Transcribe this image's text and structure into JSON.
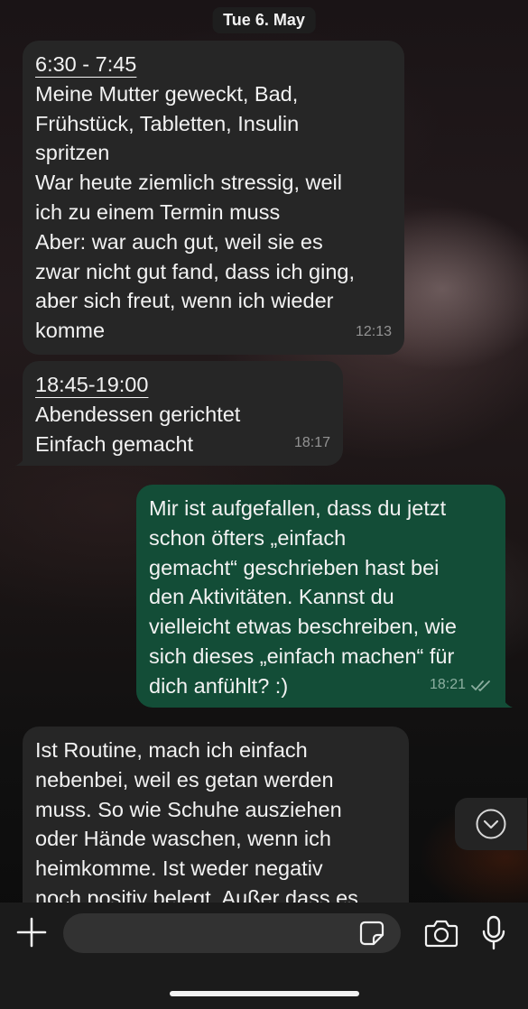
{
  "date_header": "Tue 6. May",
  "messages": [
    {
      "direction": "incoming",
      "title": "6:30 - 7:45",
      "lines": [
        "Meine Mutter geweckt, Bad,",
        "Frühstück, Tabletten, Insulin",
        "spritzen",
        "War heute ziemlich stressig, weil",
        "ich zu einem Termin muss",
        "Aber: war auch gut, weil sie es",
        "zwar nicht gut fand, dass ich ging,",
        "aber sich freut, wenn ich wieder",
        "komme"
      ],
      "time": "12:13"
    },
    {
      "direction": "incoming",
      "title": "18:45-19:00",
      "lines": [
        "Abendessen gerichtet",
        "Einfach gemacht"
      ],
      "time": "18:17"
    },
    {
      "direction": "outgoing",
      "lines": [
        "Mir ist aufgefallen, dass du jetzt",
        "schon öfters „einfach",
        "gemacht“ geschrieben hast bei",
        "den Aktivitäten. Kannst du",
        "vielleicht etwas beschreiben, wie",
        "sich dieses „einfach machen“ für",
        "dich anfühlt? :)"
      ],
      "time": "18:21",
      "status": "read"
    },
    {
      "direction": "incoming",
      "lines": [
        "Ist Routine, mach ich einfach",
        "nebenbei, weil es getan werden",
        "muss. So wie Schuhe ausziehen",
        "oder Hände waschen, wenn ich",
        "heimkomme. Ist weder negativ",
        "noch positiv belegt. Außer dass es"
      ]
    }
  ],
  "composer": {
    "placeholder": "",
    "icons": [
      "plus-icon",
      "sticker-icon",
      "camera-icon",
      "microphone-icon"
    ]
  },
  "colors": {
    "incoming_bubble": "#262626",
    "outgoing_bubble": "#134d37",
    "text": "#f2f2f2",
    "meta": "#8c8c8c"
  }
}
